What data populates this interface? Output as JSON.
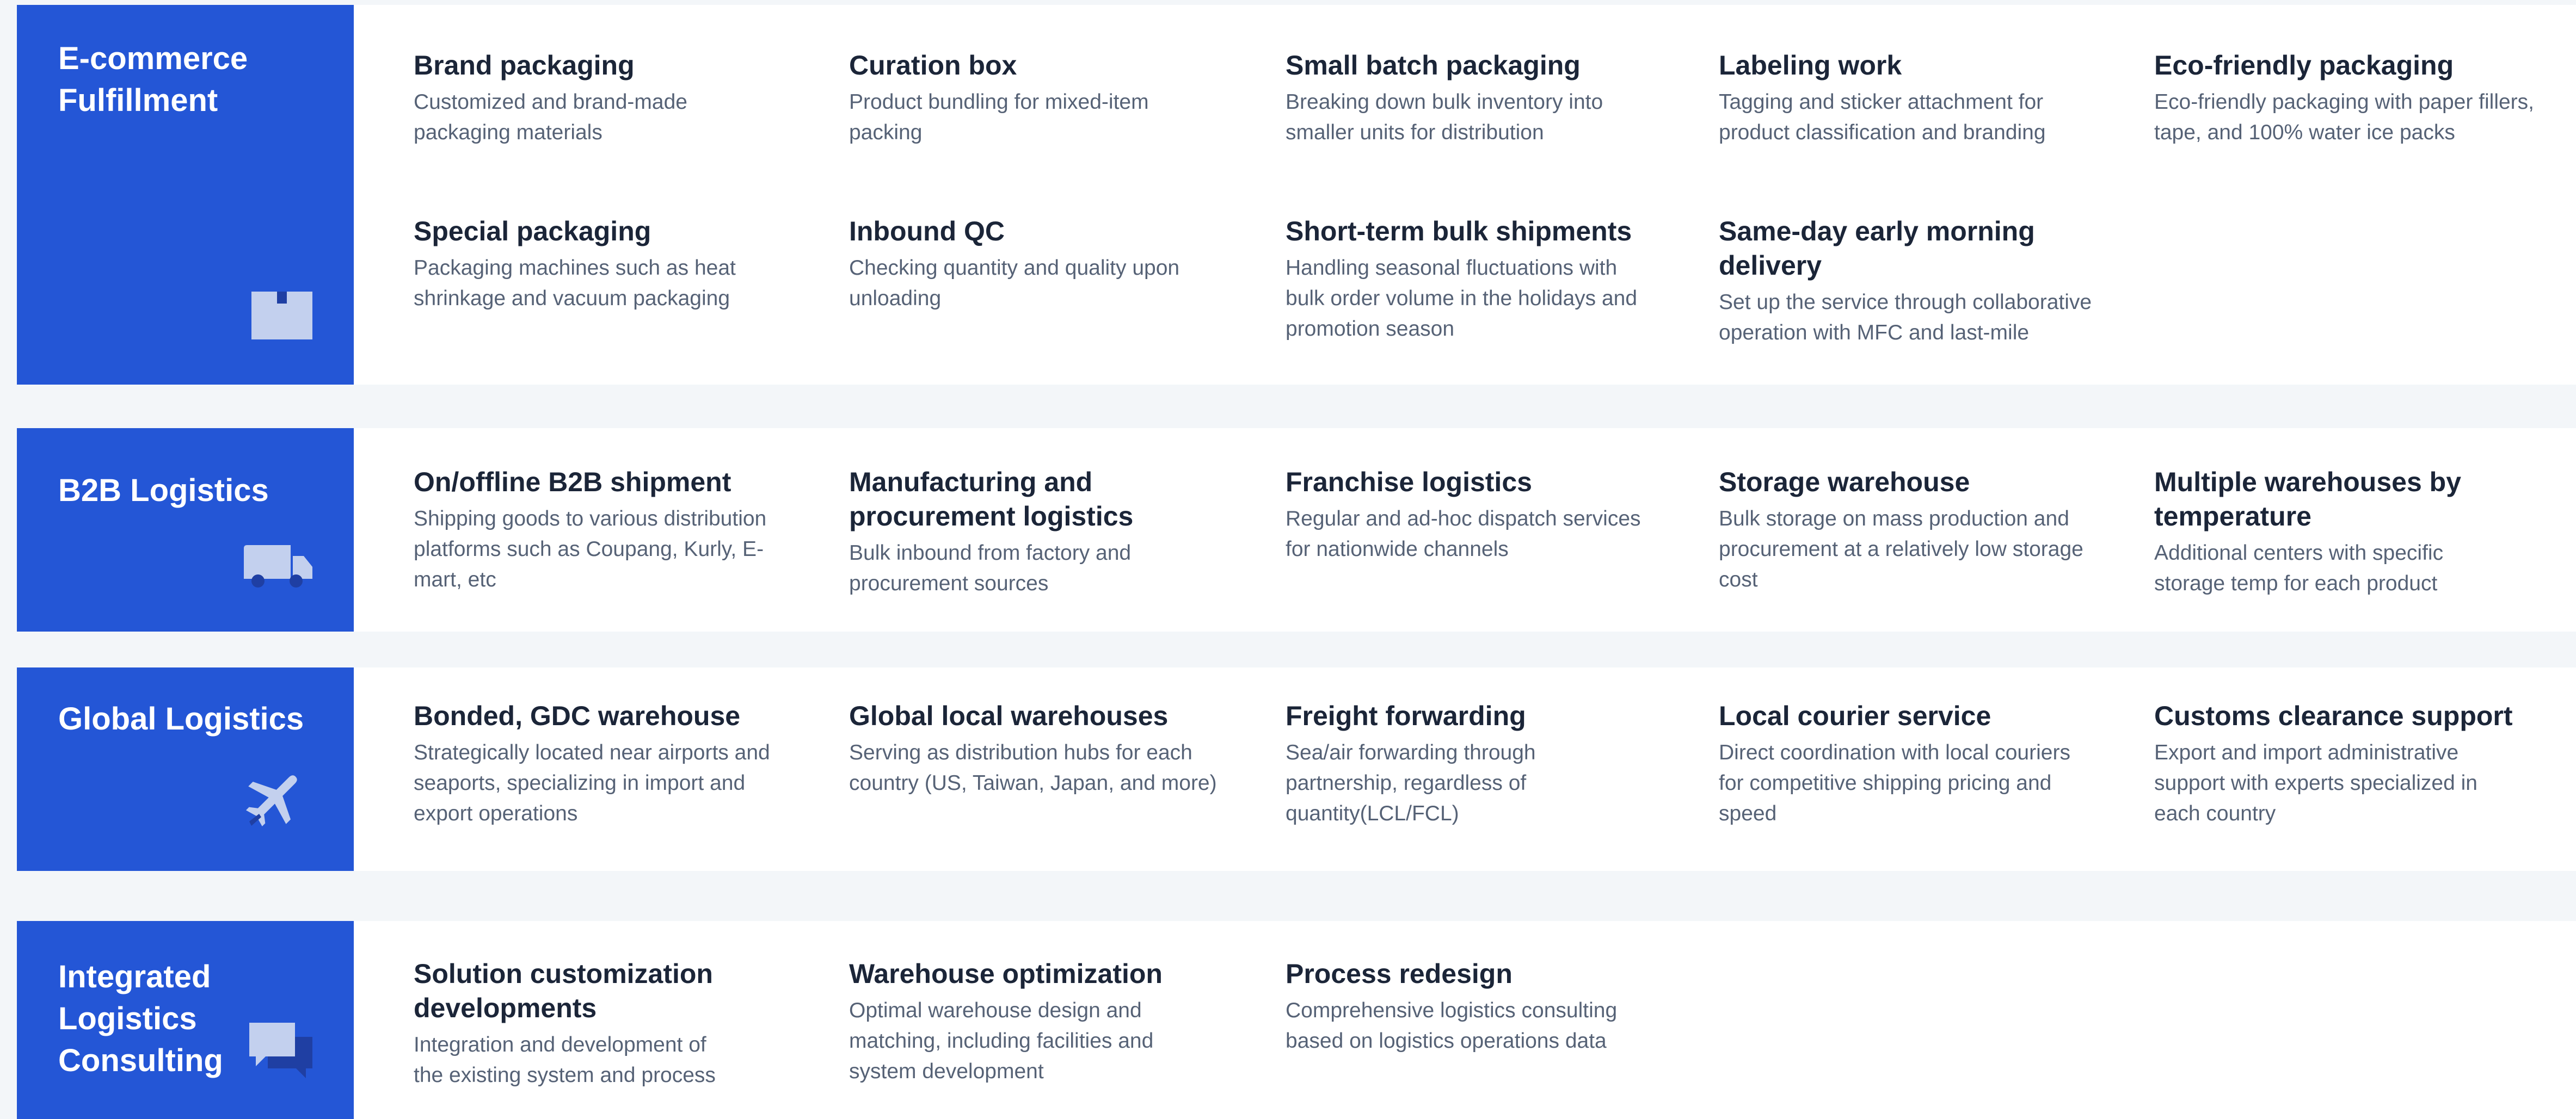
{
  "sections": [
    {
      "title": "E-commerce\nFulfillment",
      "icon": "box-icon",
      "items": [
        {
          "title": "Brand packaging",
          "desc": "Customized and brand-made packaging materials"
        },
        {
          "title": "Curation box",
          "desc": "Product bundling for mixed-item packing"
        },
        {
          "title": "Small batch packaging",
          "desc": "Breaking down bulk inventory into smaller units for distribution"
        },
        {
          "title": "Labeling work",
          "desc": "Tagging and sticker attachment for product classification and branding"
        },
        {
          "title": "Eco-friendly packaging",
          "desc": "Eco-friendly packaging with paper fillers, tape, and 100% water ice packs"
        },
        {
          "title": "Special packaging",
          "desc": "Packaging machines such as heat shrinkage and vacuum packaging"
        },
        {
          "title": "Inbound QC",
          "desc": "Checking quantity and quality upon unloading"
        },
        {
          "title": "Short-term bulk shipments",
          "desc": "Handling seasonal fluctuations with bulk order volume in the holidays and promotion season"
        },
        {
          "title": "Same-day early morning delivery",
          "desc": "Set up the service through collaborative operation with MFC and last-mile"
        }
      ]
    },
    {
      "title": "B2B Logistics",
      "icon": "truck-icon",
      "items": [
        {
          "title": "On/offline B2B shipment",
          "desc": "Shipping goods to various distribution platforms such as Coupang, Kurly, E-mart, etc"
        },
        {
          "title": "Manufacturing and procurement logistics",
          "desc": "Bulk inbound from factory and procurement sources"
        },
        {
          "title": "Franchise logistics",
          "desc": "Regular and ad-hoc dispatch services for nationwide channels"
        },
        {
          "title": "Storage warehouse",
          "desc": "Bulk storage on mass production and procurement at a relatively low storage cost"
        },
        {
          "title": "Multiple warehouses by temperature",
          "desc": "Additional centers with specific storage temp for each product"
        }
      ]
    },
    {
      "title": "Global Logistics",
      "icon": "airplane-icon",
      "items": [
        {
          "title": "Bonded, GDC warehouse",
          "desc": "Strategically located near airports and seaports, specializing in import and export operations"
        },
        {
          "title": "Global local warehouses",
          "desc": "Serving as distribution hubs for each country (US, Taiwan, Japan, and more)"
        },
        {
          "title": "Freight forwarding",
          "desc": "Sea/air forwarding through partnership, regardless of quantity(LCL/FCL)"
        },
        {
          "title": "Local courier service",
          "desc": "Direct coordination with local couriers for competitive shipping pricing and speed"
        },
        {
          "title": "Customs clearance support",
          "desc": "Export and import administrative support with experts specialized in each country"
        }
      ]
    },
    {
      "title": "Integrated\nLogistics\nConsulting",
      "icon": "chat-bubbles-icon",
      "items": [
        {
          "title": "Solution customization developments",
          "desc": "Integration and development of the existing system and process"
        },
        {
          "title": "Warehouse optimization",
          "desc": "Optimal warehouse design and matching, including facilities and system development"
        },
        {
          "title": "Process redesign",
          "desc": "Comprehensive logistics consulting based on logistics operations data"
        }
      ]
    }
  ]
}
